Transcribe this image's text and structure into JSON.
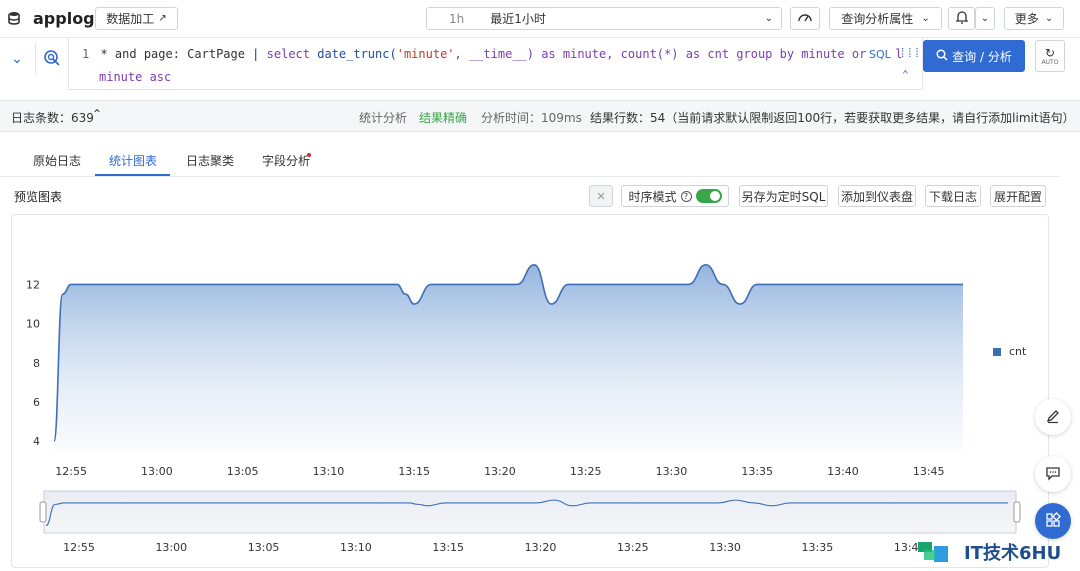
{
  "header": {
    "app_name": "applog",
    "data_process_label": "数据加工",
    "time_short": "1h",
    "time_range": "最近1小时",
    "query_attr_label": "查询分析属性",
    "more_label": "更多"
  },
  "query": {
    "line_number": "1",
    "line1_prefix": "* and page: CartPage | ",
    "line1_select": "select",
    "line1_fn": "date_trunc(",
    "line1_str": "'minute'",
    "line1_rest": ", __time__)  as minute, count(*) as cnt group by minute order l",
    "line2": "minute asc",
    "sql_label": "SQL",
    "run_label": "查询 / 分析",
    "auto_label": "AUTO"
  },
  "status": {
    "log_count": "日志条数：639",
    "stat_mode": "统计分析",
    "precise": "结果精确",
    "analysis_time": "分析时间：109ms",
    "result_rows": "结果行数：54（当前请求默认限制返回100行，若要获取更多结果，请自行添加limit语句）"
  },
  "tabs": [
    "原始日志",
    "统计图表",
    "日志聚类",
    "字段分析"
  ],
  "active_tab": 1,
  "toolbar": {
    "preview_label": "预览图表",
    "timeseries_label": "时序模式",
    "save_sql_label": "另存为定时SQL",
    "add_dashboard_label": "添加到仪表盘",
    "download_label": "下载日志",
    "expand_label": "展开配置"
  },
  "chart_data": {
    "type": "area",
    "title": "",
    "xlabel": "",
    "ylabel": "",
    "ylim": [
      3.5,
      13.4
    ],
    "yticks": [
      4,
      6,
      8,
      10,
      12
    ],
    "xticks": [
      "12:55",
      "13:00",
      "13:05",
      "13:10",
      "13:15",
      "13:20",
      "13:25",
      "13:30",
      "13:35",
      "13:40",
      "13:45"
    ],
    "legend": {
      "position": "right",
      "entries": [
        "cnt"
      ]
    },
    "series": [
      {
        "name": "cnt",
        "color": "#3d6fb6",
        "x_minutes_from_1254": [
          0,
          0.5,
          1,
          2,
          5,
          10,
          15,
          20,
          20.5,
          21,
          22,
          23,
          27,
          28,
          29,
          30,
          31,
          32,
          37,
          38,
          39,
          40,
          41,
          42,
          48,
          53
        ],
        "values": [
          4,
          11.5,
          12,
          12,
          12,
          12,
          12,
          12,
          11.5,
          11,
          12,
          12,
          12,
          13,
          11,
          12,
          12,
          12,
          12,
          13,
          12,
          11,
          12,
          12,
          12,
          12
        ]
      }
    ],
    "navigator_ticks": [
      "12:55",
      "13:00",
      "13:05",
      "13:10",
      "13:15",
      "13:20",
      "13:25",
      "13:30",
      "13:35",
      "13:40"
    ]
  },
  "watermark": "IT技术6HU",
  "colors": {
    "accent": "#2f6bd1",
    "series": "#3d6fb6",
    "toggle": "#3aa64a",
    "dot": "#d93025"
  }
}
